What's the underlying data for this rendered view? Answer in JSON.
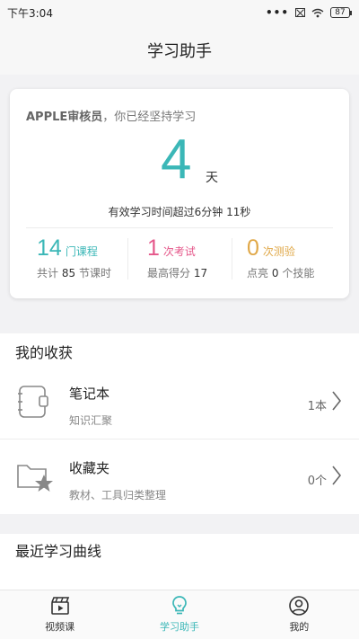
{
  "status_bar": {
    "time": "下午3:04",
    "dots": "•••",
    "battery": "87"
  },
  "header": {
    "title": "学习助手"
  },
  "summary": {
    "user": "APPLE审核员",
    "greeting_suffix": "，你已经坚持学习",
    "days": "4",
    "days_unit": "天",
    "study_time": "有效学习时间超过6分钟 11秒",
    "stats": [
      {
        "num": "14",
        "unit": "门课程",
        "sub_prefix": "共计",
        "sub_value": "85",
        "sub_suffix": "节课时",
        "color": "#3bb7b7"
      },
      {
        "num": "1",
        "unit": "次考试",
        "sub_prefix": "最高得分",
        "sub_value": "17",
        "sub_suffix": "",
        "color": "#e5578a"
      },
      {
        "num": "0",
        "unit": "次测验",
        "sub_prefix": "点亮",
        "sub_value": "0",
        "sub_suffix": "个技能",
        "color": "#e0a848"
      }
    ]
  },
  "gains": {
    "title": "我的收获",
    "items": [
      {
        "title": "笔记本",
        "sub": "知识汇聚",
        "count": "1本",
        "icon": "notebook-icon"
      },
      {
        "title": "收藏夹",
        "sub": "教材、工具归类整理",
        "count": "0个",
        "icon": "favorites-folder-icon"
      }
    ]
  },
  "curve": {
    "title": "最近学习曲线"
  },
  "nav": {
    "items": [
      {
        "label": "视频课",
        "icon": "video-clapper-icon"
      },
      {
        "label": "学习助手",
        "icon": "lightbulb-icon"
      },
      {
        "label": "我的",
        "icon": "user-icon"
      }
    ]
  },
  "colors": {
    "accent": "#3bb7b7",
    "pink": "#e5578a",
    "orange": "#e0a848"
  }
}
